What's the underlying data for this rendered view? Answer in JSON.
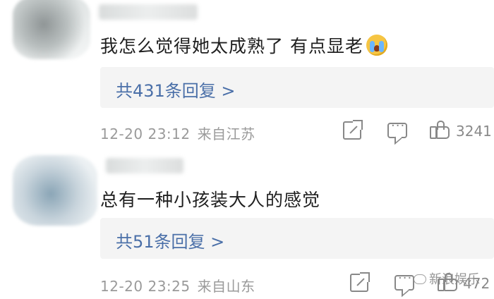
{
  "comments": [
    {
      "text": "我怎么觉得她太成熟了 有点显老",
      "emoji": "crying-face-emoji",
      "reply_link": "共431条回复 >",
      "time": "12-20 23:12",
      "location": "来自江苏",
      "likes": "3241"
    },
    {
      "text": "总有一种小孩装大人的感觉",
      "reply_link": "共51条回复 >",
      "time": "12-20 23:25",
      "location": "来自山东",
      "likes": "472"
    }
  ],
  "watermark": "新浪娱乐",
  "colors": {
    "link": "#4a6fa8",
    "meta": "#9a9a9a",
    "reply_bg": "#f4f4f4"
  }
}
